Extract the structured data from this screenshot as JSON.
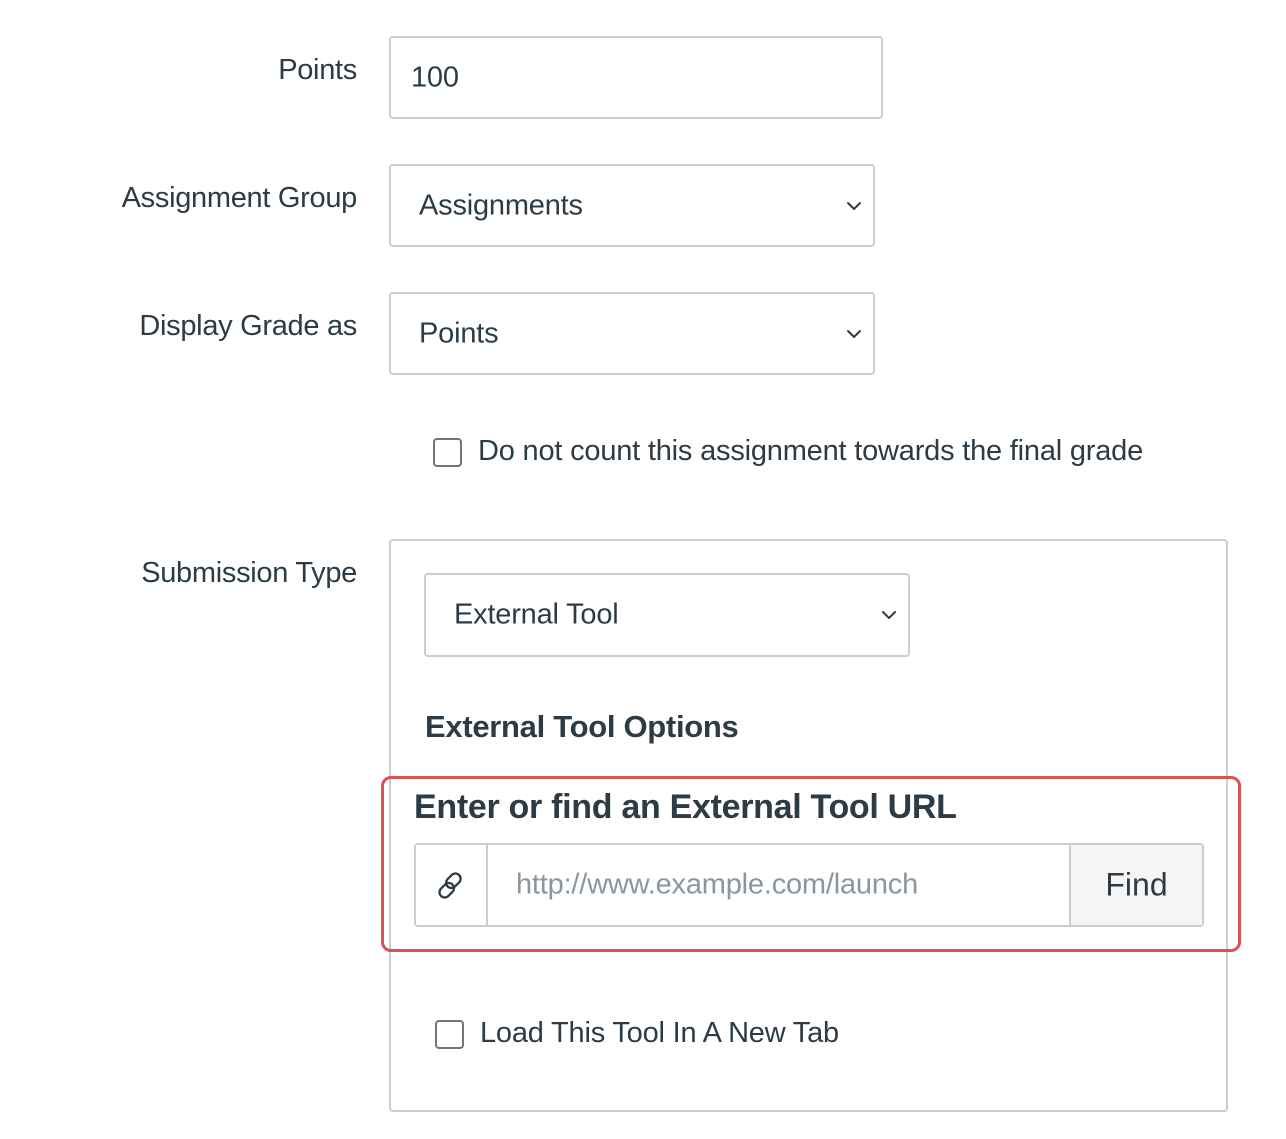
{
  "points": {
    "label": "Points",
    "value": "100"
  },
  "assignment_group": {
    "label": "Assignment Group",
    "selected": "Assignments"
  },
  "display_grade": {
    "label": "Display Grade as",
    "selected": "Points"
  },
  "final_grade_checkbox": {
    "label": "Do not count this assignment towards the final grade",
    "checked": false
  },
  "submission_type": {
    "label": "Submission Type",
    "selected": "External Tool",
    "options_heading": "External Tool Options",
    "url_heading": "Enter or find an External Tool URL",
    "url_placeholder": "http://www.example.com/launch",
    "url_value": "",
    "find_label": "Find",
    "new_tab_label": "Load This Tool In A New Tab",
    "new_tab_checked": false
  },
  "icons": {
    "link": "link-icon",
    "chevron": "chevron-down-icon"
  },
  "colors": {
    "highlight": "#d9534f",
    "border": "#c7cdd1",
    "text": "#2d3b45",
    "placeholder": "#8b969e",
    "button_bg": "#f5f5f5"
  }
}
